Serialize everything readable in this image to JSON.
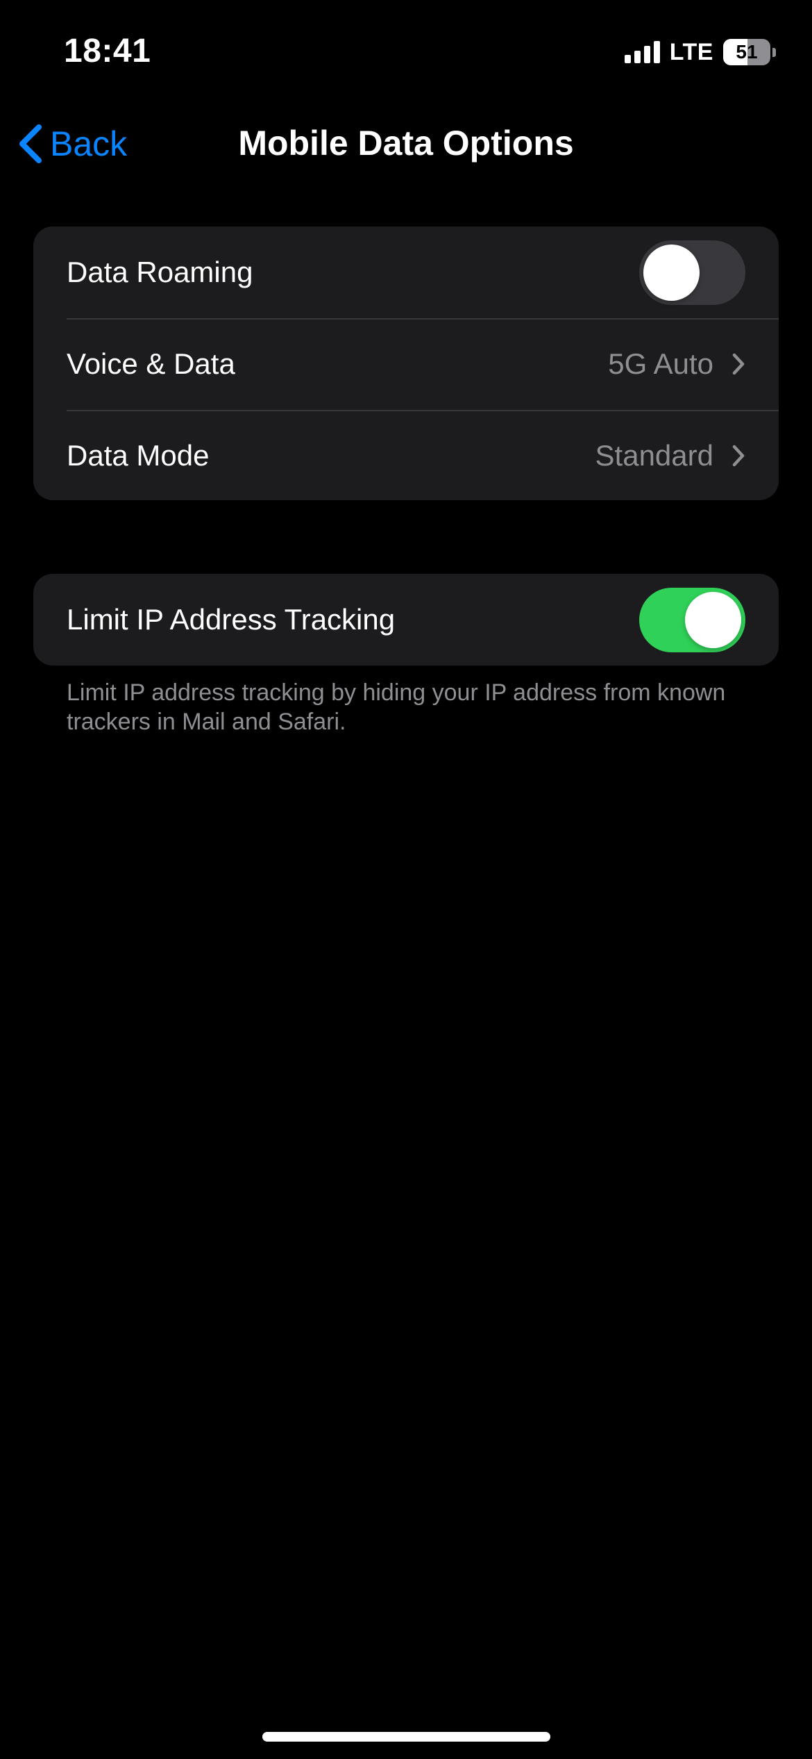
{
  "status_bar": {
    "time": "18:41",
    "network_type": "LTE",
    "battery_level": "51",
    "battery_fraction": 0.51,
    "signal_bars": 4
  },
  "nav": {
    "back_label": "Back",
    "title": "Mobile Data Options"
  },
  "groups": [
    {
      "rows": [
        {
          "label": "Data Roaming",
          "type": "toggle",
          "on": false
        },
        {
          "label": "Voice & Data",
          "type": "disclosure",
          "value": "5G Auto"
        },
        {
          "label": "Data Mode",
          "type": "disclosure",
          "value": "Standard"
        }
      ]
    },
    {
      "rows": [
        {
          "label": "Limit IP Address Tracking",
          "type": "toggle",
          "on": true
        }
      ],
      "footer": "Limit IP address tracking by hiding your IP address from known trackers in Mail and Safari."
    }
  ],
  "colors": {
    "accent": "#0a84ff",
    "toggle_on": "#30d158",
    "background": "#000000",
    "cell_background": "#1c1c1e",
    "secondary_text": "#8e8e93"
  },
  "icons": {
    "back": "chevron-left-icon",
    "disclosure": "chevron-right-icon"
  }
}
